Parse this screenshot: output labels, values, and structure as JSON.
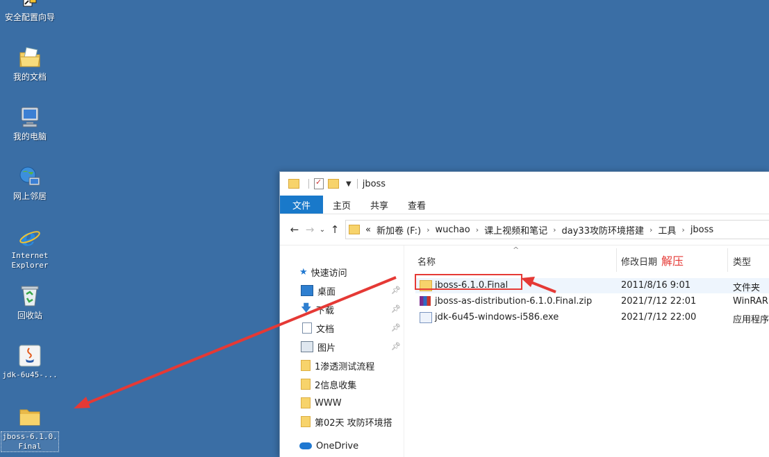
{
  "desktop": {
    "icons": [
      {
        "label": "安全配置向导",
        "icon": "wizard-shortcut-icon"
      },
      {
        "label": "我的文档",
        "icon": "documents-folder-icon"
      },
      {
        "label": "我的电脑",
        "icon": "computer-icon"
      },
      {
        "label": "网上邻居",
        "icon": "network-icon"
      },
      {
        "label": "Internet\nExplorer",
        "icon": "ie-icon"
      },
      {
        "label": "回收站",
        "icon": "recycle-bin-icon"
      },
      {
        "label": "jdk-6u45-...",
        "icon": "java-installer-icon"
      },
      {
        "label": "jboss-6.1.0.\nFinal",
        "icon": "folder-icon"
      }
    ]
  },
  "window": {
    "title": "jboss",
    "ribbon_tabs": [
      "文件",
      "主页",
      "共享",
      "查看"
    ],
    "address": {
      "overflow": "«",
      "crumbs": [
        "新加卷 (F:)",
        "wuchao",
        "课上视频和笔记",
        "day33攻防环境搭建",
        "工具",
        "jboss"
      ]
    },
    "nav_pane": {
      "quick_access": "快速访问",
      "items": [
        {
          "label": "桌面",
          "pinned": true,
          "icon": "desktop-icon"
        },
        {
          "label": "下载",
          "pinned": true,
          "icon": "download-icon"
        },
        {
          "label": "文档",
          "pinned": true,
          "icon": "document-icon"
        },
        {
          "label": "图片",
          "pinned": true,
          "icon": "pictures-icon"
        },
        {
          "label": "1渗透测试流程",
          "pinned": false,
          "icon": "folder-icon"
        },
        {
          "label": "2信息收集",
          "pinned": false,
          "icon": "folder-icon"
        },
        {
          "label": "WWW",
          "pinned": false,
          "icon": "folder-icon"
        },
        {
          "label": "第02天 攻防环境搭",
          "pinned": false,
          "icon": "folder-icon"
        }
      ],
      "onedrive": "OneDrive"
    },
    "columns": {
      "name": "名称",
      "date": "修改日期",
      "type": "类型"
    },
    "files": [
      {
        "name": "jboss-6.1.0.Final",
        "date": "2011/8/16 9:01",
        "type": "文件夹",
        "icon": "folder-icon"
      },
      {
        "name": "jboss-as-distribution-6.1.0.Final.zip",
        "date": "2021/7/12 22:01",
        "type": "WinRAR",
        "icon": "winrar-icon"
      },
      {
        "name": "jdk-6u45-windows-i586.exe",
        "date": "2021/7/12 22:00",
        "type": "应用程序",
        "icon": "exe-icon"
      }
    ]
  },
  "annotation": {
    "text": "解压",
    "color": "#e53935"
  },
  "colors": {
    "desktop": "#3a6ea5",
    "accent": "#1979ca",
    "annotation": "#e53935"
  }
}
